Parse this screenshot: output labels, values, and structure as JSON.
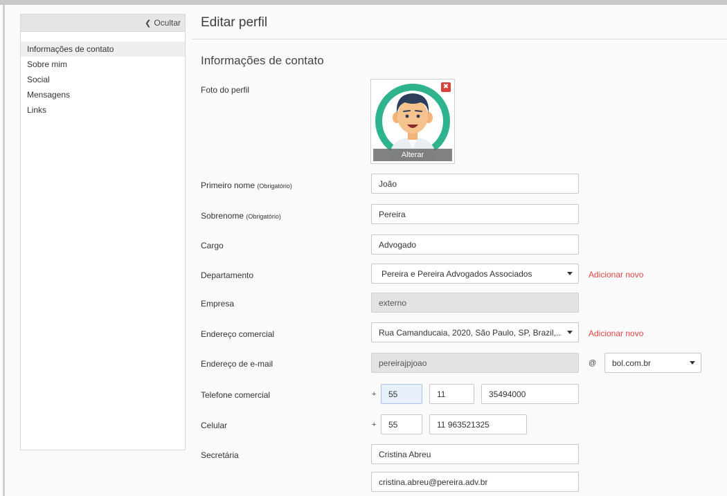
{
  "sidebar": {
    "hide_label": "Ocultar",
    "items": [
      {
        "label": "Informações de contato",
        "active": true
      },
      {
        "label": "Sobre mim"
      },
      {
        "label": "Social"
      },
      {
        "label": "Mensagens"
      },
      {
        "label": "Links"
      }
    ]
  },
  "page_title": "Editar perfil",
  "section_title": "Informações de contato",
  "photo": {
    "label": "Foto do perfil",
    "change_label": "Alterar",
    "delete_icon": "close-icon"
  },
  "form": {
    "first_name": {
      "label": "Primeiro nome",
      "note": "(Obrigatório)",
      "value": "João"
    },
    "last_name": {
      "label": "Sobrenome",
      "note": "(Obrigatório)",
      "value": "Pereira"
    },
    "job_title": {
      "label": "Cargo",
      "value": "Advogado"
    },
    "department": {
      "label": "Departamento",
      "value": "Pereira e Pereira Advogados Associados",
      "add_new": "Adicionar novo"
    },
    "company": {
      "label": "Empresa",
      "value": "externo"
    },
    "business_address": {
      "label": "Endereço comercial",
      "value": "Rua Camanducaia, 2020, São Paulo, SP, Brazil,...",
      "add_new": "Adicionar novo"
    },
    "email": {
      "label": "Endereço de e-mail",
      "user": "pereirajpjoao",
      "at": "@",
      "domain": "bol.com.br"
    },
    "business_phone": {
      "label": "Telefone comercial",
      "plus": "+",
      "country": "55",
      "area": "11",
      "number": "35494000"
    },
    "mobile": {
      "label": "Celular",
      "plus": "+",
      "country": "55",
      "number": "11 963521325"
    },
    "secretary": {
      "label": "Secretária",
      "name": "Cristina Abreu",
      "email": "cristina.abreu@pereira.adv.br"
    }
  },
  "colors": {
    "accent_red": "#e24545",
    "avatar_teal": "#2fb38e",
    "focus_bg": "#e7f0fb"
  }
}
